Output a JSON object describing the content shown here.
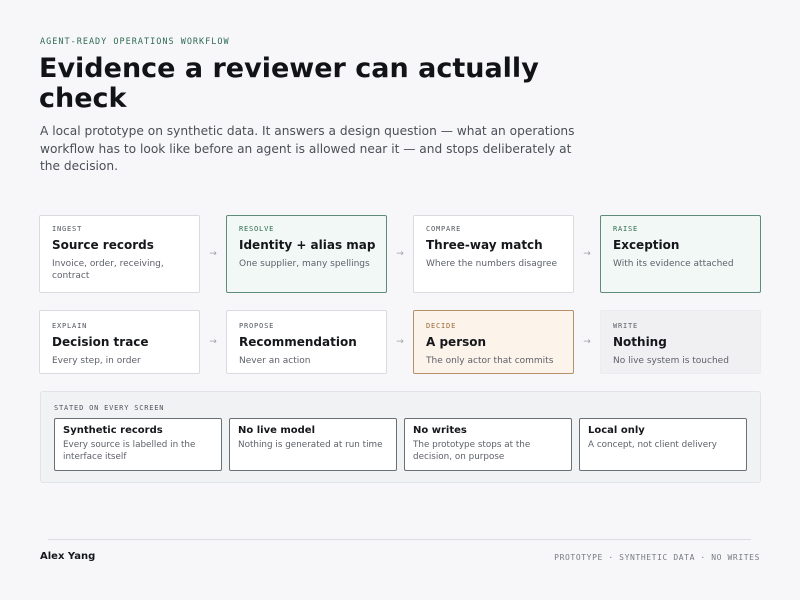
{
  "header": {
    "eyebrow": "AGENT-READY OPERATIONS WORKFLOW",
    "title": "Evidence a reviewer can actually check",
    "intro": "A local prototype on synthetic data. It answers a design question — what an operations workflow has to look like before an agent is allowed near it — and stops deliberately at the decision."
  },
  "flow": {
    "arrow": "→",
    "row1": [
      {
        "step": "INGEST",
        "title": "Source records",
        "sub": "Invoice, order, receiving, contract"
      },
      {
        "step": "RESOLVE",
        "title": "Identity + alias map",
        "sub": "One supplier, many spellings"
      },
      {
        "step": "COMPARE",
        "title": "Three-way match",
        "sub": "Where the numbers disagree"
      },
      {
        "step": "RAISE",
        "title": "Exception",
        "sub": "With its evidence attached"
      }
    ],
    "row2": [
      {
        "step": "EXPLAIN",
        "title": "Decision trace",
        "sub": "Every step, in order"
      },
      {
        "step": "PROPOSE",
        "title": "Recommendation",
        "sub": "Never an action"
      },
      {
        "step": "DECIDE",
        "title": "A person",
        "sub": "The only actor that commits"
      },
      {
        "step": "WRITE",
        "title": "Nothing",
        "sub": "No live system is touched"
      }
    ]
  },
  "stated": {
    "label": "STATED ON EVERY SCREEN",
    "items": [
      {
        "title": "Synthetic records",
        "desc": "Every source is labelled in the interface itself"
      },
      {
        "title": "No live model",
        "desc": "Nothing is generated at run time"
      },
      {
        "title": "No writes",
        "desc": "The prototype stops at the decision, on purpose"
      },
      {
        "title": "Local only",
        "desc": "A concept, not client delivery"
      }
    ]
  },
  "footer": {
    "author": "Alex Yang",
    "tag": "PROTOTYPE · SYNTHETIC DATA · NO WRITES"
  },
  "colors": {
    "accent_green": "#2f6b52",
    "decide_warm": "#b4906c",
    "background": "#f7f7f9"
  }
}
